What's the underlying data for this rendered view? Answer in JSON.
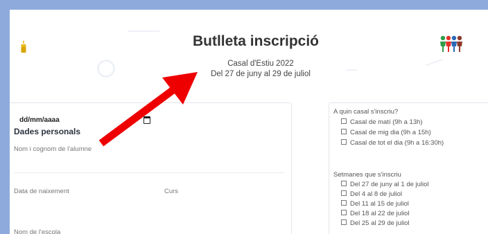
{
  "header": {
    "title": "Butlleta inscripció",
    "subtitle": "Casal d'Estiu 2022",
    "dates": "Del 27 de juny al 29 de juliol"
  },
  "personal": {
    "section_title": "Dades personals",
    "name_label": "Nom i cognom de l'alumne",
    "birth_label": "Data de naixement",
    "birth_placeholder": "dd/mm/aaaa",
    "course_label": "Curs",
    "school_label": "Nom de l'escola"
  },
  "casal": {
    "question": "A quin casal s'inscriu?",
    "options": [
      "Casal de matí (9h a 13h)",
      "Casal de mig dia (9h a 15h)",
      "Casal de tot el dia (9h a 16:30h)"
    ]
  },
  "weeks": {
    "question": "Setmanes que s'inscriu",
    "options": [
      "Del 27 de juny al 1 de juliol",
      "Del 4 al 8 de juliol",
      "Del 11 al 15 de juliol",
      "Del 18 al 22 de juliol",
      "Del 25 al 29 de juliol"
    ]
  },
  "colors": {
    "background": "#8eaadd",
    "arrow": "#ee0000"
  },
  "icons": [
    "candle-logo-icon",
    "children-group-logo-icon",
    "calendar-icon",
    "red-arrow-annotation"
  ]
}
